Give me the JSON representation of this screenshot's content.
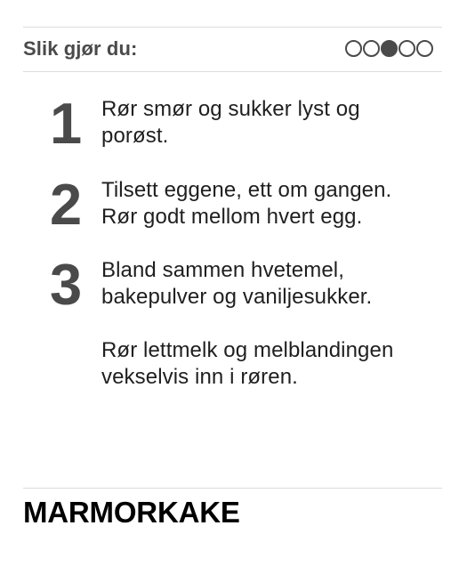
{
  "header": {
    "title": "Slik gjør du:",
    "progress": {
      "total": 5,
      "active_index": 3
    }
  },
  "steps": [
    {
      "number": "1",
      "paragraphs": [
        "Rør smør og sukker lyst og porøst."
      ]
    },
    {
      "number": "2",
      "paragraphs": [
        "Tilsett eggene, ett om gangen. Rør godt mellom hvert egg."
      ]
    },
    {
      "number": "3",
      "paragraphs": [
        "Bland sammen hvetemel, bakepulver og vaniljesukker.",
        "Rør lettmelk og melblandingen vekselvis inn i røren."
      ]
    }
  ],
  "footer": {
    "title": "MARMORKAKE"
  },
  "colors": {
    "header_text": "#4a4a4a",
    "step_number": "#4a4a4a",
    "body_text": "#1f1f1f",
    "rule": "#dcdcdc",
    "footer_text": "#000000"
  },
  "icons": {
    "progress_dot_empty": "outlined-circle-icon",
    "progress_dot_active": "filled-circle-icon"
  }
}
